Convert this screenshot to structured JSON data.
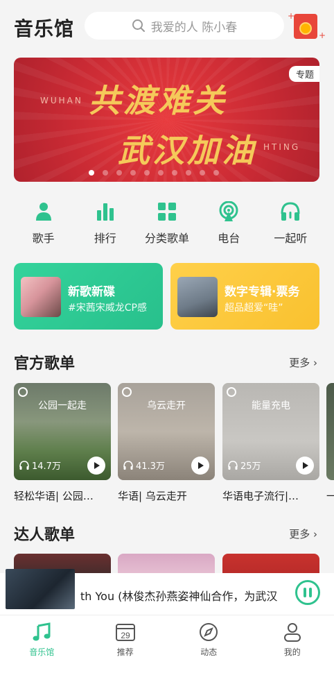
{
  "header": {
    "title": "音乐馆",
    "search_placeholder": "我爱的人 陈小春"
  },
  "banner": {
    "tag": "专题",
    "line1": "共渡难关",
    "line2": "武汉加油",
    "en_left": "WUHAN",
    "en_right": "HTING",
    "page_count": 10,
    "active_page": 1
  },
  "shortcuts": [
    {
      "label": "歌手",
      "icon": "singer-icon"
    },
    {
      "label": "排行",
      "icon": "chart-icon"
    },
    {
      "label": "分类歌单",
      "icon": "category-icon"
    },
    {
      "label": "电台",
      "icon": "radio-icon"
    },
    {
      "label": "一起听",
      "icon": "headphones-icon"
    }
  ],
  "promos": [
    {
      "title": "新歌新碟",
      "subtitle": "#宋茜宋威龙CP感"
    },
    {
      "title": "数字专辑·票务",
      "subtitle": "超品超爱“哇”"
    }
  ],
  "official": {
    "title": "官方歌单",
    "more": "更多",
    "items": [
      {
        "cover_title": "公园一起走",
        "count": "14.7万",
        "name": "轻松华语| 公园…"
      },
      {
        "cover_title": "乌云走开",
        "count": "41.3万",
        "name": "华语| 乌云走开"
      },
      {
        "cover_title": "能量充电",
        "count": "25万",
        "name": "华语电子流行|…"
      },
      {
        "name": "一"
      }
    ]
  },
  "talent": {
    "title": "达人歌单",
    "more": "更多"
  },
  "player": {
    "track": "th You (林俊杰孙燕姿神仙合作，为武汉"
  },
  "tabs": [
    {
      "label": "音乐馆",
      "active": true
    },
    {
      "label": "推荐",
      "icon_text": "29"
    },
    {
      "label": "动态"
    },
    {
      "label": "我的"
    }
  ],
  "colors": {
    "accent": "#2fc28e",
    "banner_red": "#c92a34",
    "banner_gold": "#f5c95a"
  }
}
